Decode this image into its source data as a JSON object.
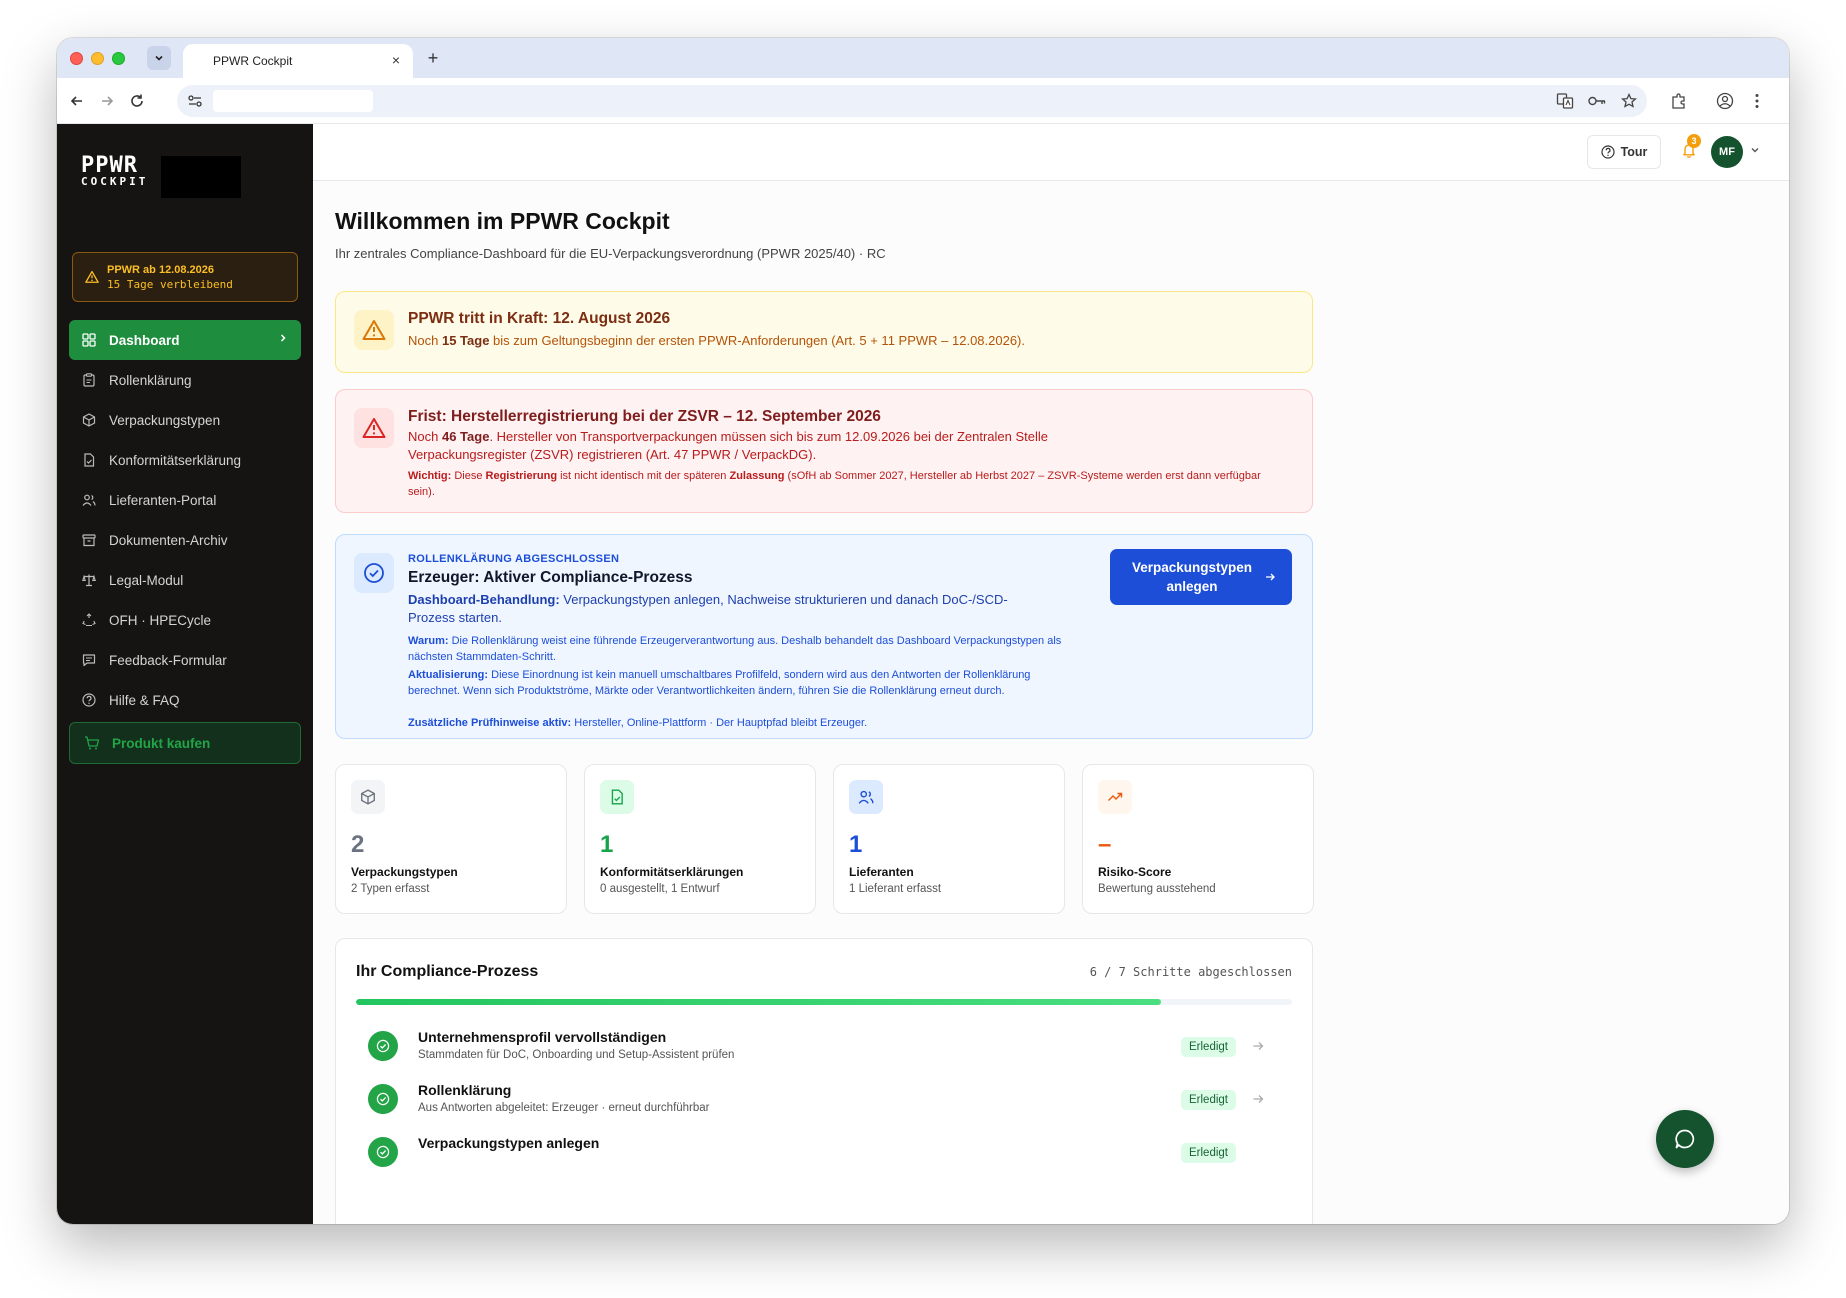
{
  "browser": {
    "tab_title": "PPWR Cockpit",
    "tab_close": "×",
    "new_tab": "+"
  },
  "sidebar": {
    "logo_line1": "PPWR",
    "logo_line2": "COCKPIT",
    "countdown_date": "PPWR ab 12.08.2026",
    "countdown_days": "15 Tage verbleibend",
    "items": [
      {
        "label": "Dashboard",
        "icon": "grid-icon",
        "active": true
      },
      {
        "label": "Rollenklärung",
        "icon": "clipboard-icon"
      },
      {
        "label": "Verpackungstypen",
        "icon": "package-icon"
      },
      {
        "label": "Konformitätserklärung",
        "icon": "file-check-icon"
      },
      {
        "label": "Lieferanten-Portal",
        "icon": "users-icon"
      },
      {
        "label": "Dokumenten-Archiv",
        "icon": "archive-icon"
      },
      {
        "label": "Legal-Modul",
        "icon": "scale-icon"
      },
      {
        "label": "OFH · HPECycle",
        "icon": "recycle-icon"
      },
      {
        "label": "Feedback-Formular",
        "icon": "message-icon"
      },
      {
        "label": "Hilfe & FAQ",
        "icon": "help-icon"
      }
    ],
    "buy_label": "Produkt kaufen"
  },
  "topbar": {
    "tour_label": "Tour",
    "notification_count": "3",
    "avatar_initials": "MF"
  },
  "page": {
    "title": "Willkommen im PPWR Cockpit",
    "subtitle": "Ihr zentrales Compliance-Dashboard für die EU-Verpackungsverordnung (PPWR 2025/40) · RC"
  },
  "alert_yellow": {
    "title": "PPWR tritt in Kraft: 12. August 2026",
    "pre": "Noch ",
    "days": "15",
    "unit": " Tage",
    "post": " bis zum Geltungsbeginn der ersten PPWR-Anforderungen (Art. 5 + 11 PPWR – 12.08.2026)."
  },
  "alert_red": {
    "title": "Frist: Herstellerregistrierung bei der ZSVR – 12. September 2026",
    "pre": "Noch ",
    "days": "46",
    "unit": " Tage",
    "post": ". Hersteller von Transportverpackungen müssen sich bis zum 12.09.2026 bei der Zentralen Stelle Verpackungsregister (ZSVR) registrieren (Art. 47 PPWR / VerpackDG).",
    "note_label": "Wichtig:",
    "note_a": " Diese ",
    "note_b": "Registrierung",
    "note_c": " ist nicht identisch mit der späteren ",
    "note_d": "Zulassung",
    "note_e": " (sOfH ab Sommer 2027, Hersteller ab Herbst 2027 – ZSVR-Systeme werden erst dann verfügbar sein)."
  },
  "alert_blue": {
    "label": "ROLLENKLÄRUNG ABGESCHLOSSEN",
    "title": "Erzeuger: Aktiver Compliance-Prozess",
    "text_label": "Dashboard-Behandlung:",
    "text": " Verpackungstypen anlegen, Nachweise strukturieren und danach DoC-/SCD-Prozess starten.",
    "why_label": "Warum:",
    "why": " Die Rollenklärung weist eine führende Erzeugerverantwortung aus. Deshalb behandelt das Dashboard Verpackungstypen als nächsten Stammdaten-Schritt.",
    "update_label": "Aktualisierung:",
    "update": " Diese Einordnung ist kein manuell umschaltbares Profilfeld, sondern wird aus den Antworten der Rollenklärung berechnet. Wenn sich Produktströme, Märkte oder Verantwortlichkeiten ändern, führen Sie die Rollenklärung erneut durch.",
    "extra_label": "Zusätzliche Prüfhinweise aktiv:",
    "extra": " Hersteller, Online-Plattform · Der Hauptpfad bleibt Erzeuger.",
    "cta_label": "Verpackungstypen anlegen"
  },
  "stats": [
    {
      "value": "2",
      "label": "Verpackungstypen",
      "sub": "2 Typen erfasst",
      "icon": "package-icon",
      "color": "#6b7280"
    },
    {
      "value": "1",
      "label": "Konformitätserklärungen",
      "sub": "0 ausgestellt, 1 Entwurf",
      "icon": "file-check-icon",
      "color": "#16a34a"
    },
    {
      "value": "1",
      "label": "Lieferanten",
      "sub": "1 Lieferant erfasst",
      "icon": "users-icon",
      "color": "#1d4ed8"
    },
    {
      "value": "–",
      "label": "Risiko-Score",
      "sub": "Bewertung ausstehend",
      "icon": "trending-up-icon",
      "color": "#ea580c"
    }
  ],
  "process": {
    "title": "Ihr Compliance-Prozess",
    "count": "6 / 7 Schritte abgeschlossen",
    "progress": 0.86,
    "steps": [
      {
        "title": "Unternehmensprofil vervollständigen",
        "desc": "Stammdaten für DoC, Onboarding und Setup-Assistent prüfen",
        "status": "Erledigt"
      },
      {
        "title": "Rollenklärung",
        "desc": "Aus Antworten abgeleitet: Erzeuger · erneut durchführbar",
        "status": "Erledigt"
      },
      {
        "title": "Verpackungstypen anlegen",
        "desc": "",
        "status": "Erledigt"
      }
    ]
  },
  "colors": {
    "sidebar_bg": "#161412",
    "accent_green": "#1e8e3e",
    "primary_blue": "#1d4ed8"
  }
}
